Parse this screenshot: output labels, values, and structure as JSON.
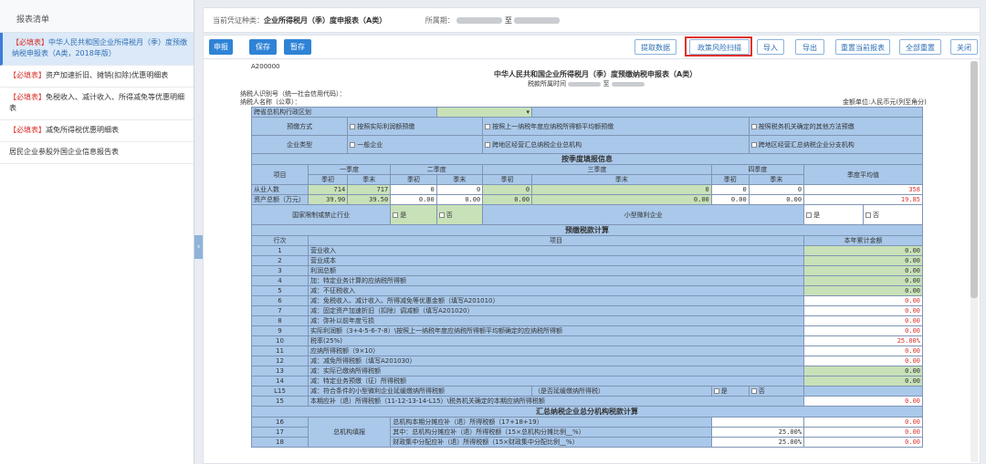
{
  "sidebar": {
    "title": "报表清单",
    "items": [
      {
        "tag": "【必填表】",
        "label": "中华人民共和国企业所得税月（季）度预缴纳税申报表（A类，2018年版）"
      },
      {
        "tag": "【必填表】",
        "label": "资产加速折旧、摊销(扣除)优惠明细表"
      },
      {
        "tag": "【必填表】",
        "label": "免税收入、减计收入、所得减免等优惠明细表"
      },
      {
        "tag": "【必填表】",
        "label": "减免所得税优惠明细表"
      },
      {
        "tag": "",
        "label": "居民企业参股外国企业信息报告表"
      }
    ]
  },
  "topbar": {
    "type_label": "当前凭证种类：",
    "type_value": "企业所得税月（季）度申报表（A类）",
    "period_label": "所属期：",
    "period_sep": "至"
  },
  "toolbar": {
    "declare": "申报",
    "save": "保存",
    "stash": "暂存",
    "fetch": "提取数据",
    "risk_scan": "政策风险扫描",
    "import": "导入",
    "export": "导出",
    "reset_current": "重置当前报表",
    "reset_all": "全部重置",
    "close": "关闭"
  },
  "form": {
    "code": "A200000",
    "title": "中华人民共和国企业所得税月（季）度预缴纳税申报表（A类）",
    "period_label": "税款所属时间",
    "period_sep": "至",
    "taxpayer_id": "纳税人识别号（统一社会信用代码）：",
    "taxpayer_name": "纳税人名称（公章）：",
    "unit": "金额单位:人民币元(列至角分)",
    "admin_label": "跨省总机构行政区划",
    "method_label": "预缴方式",
    "method_opts": [
      "按照实际利润额预缴",
      "按照上一纳税年度应纳税所得额平均额预缴",
      "按照税务机关确定的其他方法预缴"
    ],
    "ent_label": "企业类型",
    "ent_opts": [
      "一般企业",
      "跨地区经营汇总纳税企业总机构",
      "跨地区经营汇总纳税企业分支机构"
    ],
    "sec1": "按季度填报信息",
    "q_head": [
      "项目",
      "一季度",
      "二季度",
      "三季度",
      "四季度",
      "季度平均值"
    ],
    "q_sub": [
      "季初",
      "季末",
      "季初",
      "季末",
      "季初",
      "季末",
      "季初",
      "季末"
    ],
    "employees_label": "从业人数",
    "employees": [
      "714",
      "717",
      "0",
      "0",
      "0",
      "0",
      "0",
      "0",
      "358"
    ],
    "assets_label": "资产总额（万元）",
    "assets": [
      "39.90",
      "39.50",
      "0.00",
      "0.00",
      "0.00",
      "0.00",
      "0.00",
      "0.00",
      "19.85"
    ],
    "restricted_label": "国家限制或禁止行业",
    "small_label": "小型微利企业",
    "yes": "是",
    "no": "否",
    "sec2": "预缴税款计算",
    "calc_head": [
      "行次",
      "项目",
      "本年累计金额"
    ],
    "rows": [
      {
        "n": "1",
        "item": "营业收入",
        "v": "0.00",
        "r": false,
        "g": true
      },
      {
        "n": "2",
        "item": "营业成本",
        "v": "0.00",
        "r": false,
        "g": true
      },
      {
        "n": "3",
        "item": "利润总额",
        "v": "0.00",
        "r": false,
        "g": true
      },
      {
        "n": "4",
        "item": "加：特定业务计算的应纳税所得额",
        "v": "0.00",
        "r": false,
        "g": true
      },
      {
        "n": "5",
        "item": "减：不征税收入",
        "v": "0.00",
        "r": false,
        "g": true
      },
      {
        "n": "6",
        "item": "减：免税收入、减计收入、所得减免等优惠金额（填写A201010）",
        "v": "0.00",
        "r": true,
        "g": false
      },
      {
        "n": "7",
        "item": "减：固定资产加速折旧（扣除）调减额（填写A201020）",
        "v": "0.00",
        "r": true,
        "g": false
      },
      {
        "n": "8",
        "item": "减：弥补以前年度亏损",
        "v": "0.00",
        "r": true,
        "g": false
      },
      {
        "n": "9",
        "item": "实际利润额（3+4-5-6-7-8）\\按照上一纳税年度应纳税所得额平均额确定的应纳税所得额",
        "v": "0.00",
        "r": true,
        "g": false
      },
      {
        "n": "10",
        "item": "税率(25%)",
        "v": "25.00%",
        "r": true,
        "g": false
      },
      {
        "n": "11",
        "item": "应纳所得税额（9×10）",
        "v": "0.00",
        "r": true,
        "g": false
      },
      {
        "n": "12",
        "item": "减：减免所得税额（填写A201030）",
        "v": "0.00",
        "r": true,
        "g": false
      },
      {
        "n": "13",
        "item": "减：实际已缴纳所得税额",
        "v": "0.00",
        "r": false,
        "g": true
      },
      {
        "n": "14",
        "item": "减：特定业务预缴（征）所得税额",
        "v": "0.00",
        "r": false,
        "g": true
      },
      {
        "n": "L15",
        "item": "减：符合条件的小型微利企业延缓缴纳所得税额",
        "v": "",
        "r": false,
        "g": false,
        "defer": "（是否延缓缴纳所得税）"
      },
      {
        "n": "15",
        "item": "本期应补（退）所得税额（11-12-13-14-L15）\\税务机关确定的本期应纳所得税额",
        "v": "0.00",
        "r": true,
        "g": false
      }
    ],
    "sec3": "汇总纳税企业总分机构税款计算",
    "agg_group": "总机构填报",
    "agg_rows": [
      {
        "n": "16",
        "item": "总机构本期分摊应补（退）所得税额（17+18+19）",
        "pct": "",
        "v": "0.00"
      },
      {
        "n": "17",
        "item": "其中：总机构分摊应补（退）所得税额（15×总机构分摊比例__%）",
        "pct": "25.00%",
        "v": "0.00"
      },
      {
        "n": "18",
        "item": "财政集中分配应补（退）所得税额（15×财政集中分配比例__%）",
        "pct": "25.00%",
        "v": "0.00"
      }
    ]
  }
}
